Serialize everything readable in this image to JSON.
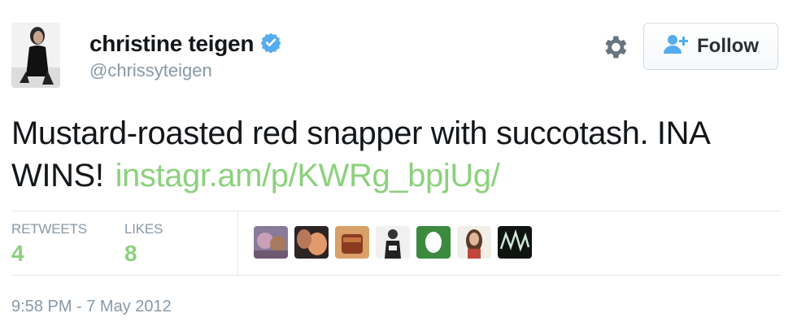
{
  "author": {
    "name": "christine teigen",
    "handle": "@chrissyteigen",
    "verified": true
  },
  "actions": {
    "follow_label": "Follow",
    "settings_icon": "gear-icon"
  },
  "tweet": {
    "text": "Mustard-roasted red snapper with succotash. INA WINS!",
    "link": "instagr.am/p/KWRg_bpjUg/",
    "timestamp": "9:58 PM - 7 May 2012"
  },
  "stats": {
    "retweets_label": "RETWEETS",
    "retweets_count": "4",
    "likes_label": "LIKES",
    "likes_count": "8"
  },
  "likers": [
    "liker-avatar-1",
    "liker-avatar-2",
    "liker-avatar-3",
    "liker-avatar-4",
    "liker-avatar-5",
    "liker-avatar-6",
    "liker-avatar-7"
  ],
  "colors": {
    "link_green": "#8cd17d",
    "verified_blue": "#55acee",
    "muted": "#8899a6",
    "text": "#14171a"
  }
}
